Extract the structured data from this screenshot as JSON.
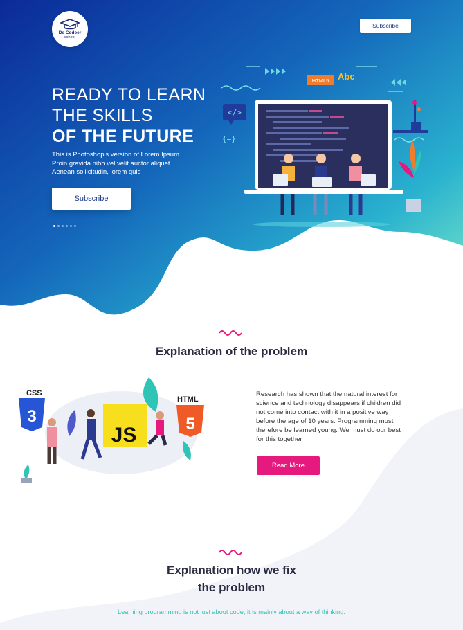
{
  "brand": {
    "logo_line1": "De Codeer",
    "logo_line2": "school"
  },
  "header": {
    "subscribe_label": "Subscribe"
  },
  "hero": {
    "title_line1": "READY TO LEARN",
    "title_line2": "THE SKILLS",
    "title_line3": "OF THE FUTURE",
    "body": "This is Photoshop's version of Lorem Ipsum. Proin gravida nibh vel velit auctor aliquet. Aenean sollicitudin, lorem quis",
    "subscribe_label": "Subscribe",
    "slide_count": 6,
    "active_slide": 1,
    "illus_html5": "HTML5",
    "illus_abc": "Abc"
  },
  "problem": {
    "title": "Explanation of the problem",
    "body": "Research has shown that the natural interest for science and technology disappears if children did not come into contact with it in a positive way before the age of 10 years. Programming must therefore be learned young. We must do our best for this together",
    "read_more_label": "Read More",
    "illus_css": "CSS",
    "illus_js": "JS",
    "illus_html": "HTML"
  },
  "fix": {
    "title_line1": "Explanation how we fix",
    "title_line2": "the problem",
    "tagline": "Learning programming is not just about code; it is mainly about a way of thinking."
  },
  "colors": {
    "hero_gradient_start": "#0a2f9a",
    "hero_gradient_end": "#35c9d4",
    "accent_pink": "#e6197f",
    "tagline_teal": "#2ec4b6"
  }
}
